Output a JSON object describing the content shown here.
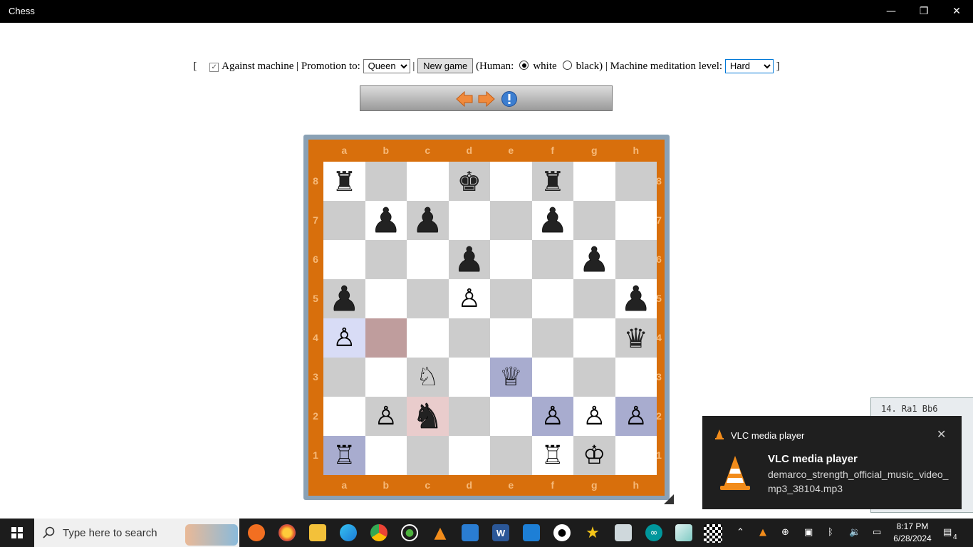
{
  "window": {
    "title": "Chess",
    "minimize": "—",
    "restore": "❐",
    "close": "✕"
  },
  "controls": {
    "open_bracket": "[",
    "against_machine_label": "Against machine",
    "sep1": "|",
    "promotion_label": "Promotion to:",
    "promotion_value": "Queen",
    "sep2": "|",
    "new_game_label": "New game",
    "human_prefix": "(Human:",
    "white_label": "white",
    "black_label": "black)",
    "sep3": "|",
    "level_label": "Machine meditation level:",
    "level_value": "Hard",
    "close_bracket": "]"
  },
  "board": {
    "files": [
      "a",
      "b",
      "c",
      "d",
      "e",
      "f",
      "g",
      "h"
    ],
    "ranks": [
      "8",
      "7",
      "6",
      "5",
      "4",
      "3",
      "2",
      "1"
    ],
    "squares": [
      [
        {
          "p": "♜",
          "c": "b",
          "s": true
        },
        {
          "p": ""
        },
        {
          "p": ""
        },
        {
          "p": "♚",
          "c": "b",
          "s": true
        },
        {
          "p": ""
        },
        {
          "p": "♜",
          "c": "b",
          "s": true
        },
        {
          "p": ""
        },
        {
          "p": ""
        }
      ],
      [
        {
          "p": ""
        },
        {
          "p": "♟",
          "c": "b"
        },
        {
          "p": "♟",
          "c": "b"
        },
        {
          "p": ""
        },
        {
          "p": ""
        },
        {
          "p": "♟",
          "c": "b"
        },
        {
          "p": ""
        },
        {
          "p": ""
        }
      ],
      [
        {
          "p": ""
        },
        {
          "p": ""
        },
        {
          "p": ""
        },
        {
          "p": "♟",
          "c": "b"
        },
        {
          "p": ""
        },
        {
          "p": ""
        },
        {
          "p": "♟",
          "c": "b"
        },
        {
          "p": ""
        }
      ],
      [
        {
          "p": "♟",
          "c": "b"
        },
        {
          "p": ""
        },
        {
          "p": ""
        },
        {
          "p": "♙",
          "c": "w"
        },
        {
          "p": ""
        },
        {
          "p": ""
        },
        {
          "p": ""
        },
        {
          "p": "♟",
          "c": "b"
        }
      ],
      [
        {
          "p": "♙",
          "c": "w",
          "hl": "#d8dcf6"
        },
        {
          "p": "",
          "hl": "#bf9d9d"
        },
        {
          "p": ""
        },
        {
          "p": ""
        },
        {
          "p": ""
        },
        {
          "p": ""
        },
        {
          "p": ""
        },
        {
          "p": "♛",
          "c": "b",
          "s": true
        }
      ],
      [
        {
          "p": ""
        },
        {
          "p": ""
        },
        {
          "p": "♘",
          "c": "w"
        },
        {
          "p": ""
        },
        {
          "p": "♕",
          "c": "w",
          "hl": "#a8accf"
        },
        {
          "p": ""
        },
        {
          "p": ""
        },
        {
          "p": ""
        }
      ],
      [
        {
          "p": ""
        },
        {
          "p": "♙",
          "c": "w"
        },
        {
          "p": "♞",
          "c": "b",
          "hl": "#e9cccc"
        },
        {
          "p": ""
        },
        {
          "p": ""
        },
        {
          "p": "♙",
          "c": "w",
          "hl": "#a8accf"
        },
        {
          "p": "♙",
          "c": "w"
        },
        {
          "p": "♙",
          "c": "w",
          "hl": "#a8accf"
        }
      ],
      [
        {
          "p": "♖",
          "c": "w",
          "hl": "#a8accf"
        },
        {
          "p": ""
        },
        {
          "p": ""
        },
        {
          "p": ""
        },
        {
          "p": ""
        },
        {
          "p": "♖",
          "c": "w"
        },
        {
          "p": "♔",
          "c": "w"
        },
        {
          "p": ""
        }
      ]
    ]
  },
  "sidewin": {
    "text": "14. Ra1 Bb6"
  },
  "toast": {
    "app": "VLC media player",
    "title": "VLC media player",
    "body": "demarco_strength_official_music_video_mp3_38104.mp3",
    "close": "✕"
  },
  "taskbar": {
    "search_placeholder": "Type here to search",
    "time": "8:17 PM",
    "date": "6/28/2024",
    "notif_count": "4"
  }
}
